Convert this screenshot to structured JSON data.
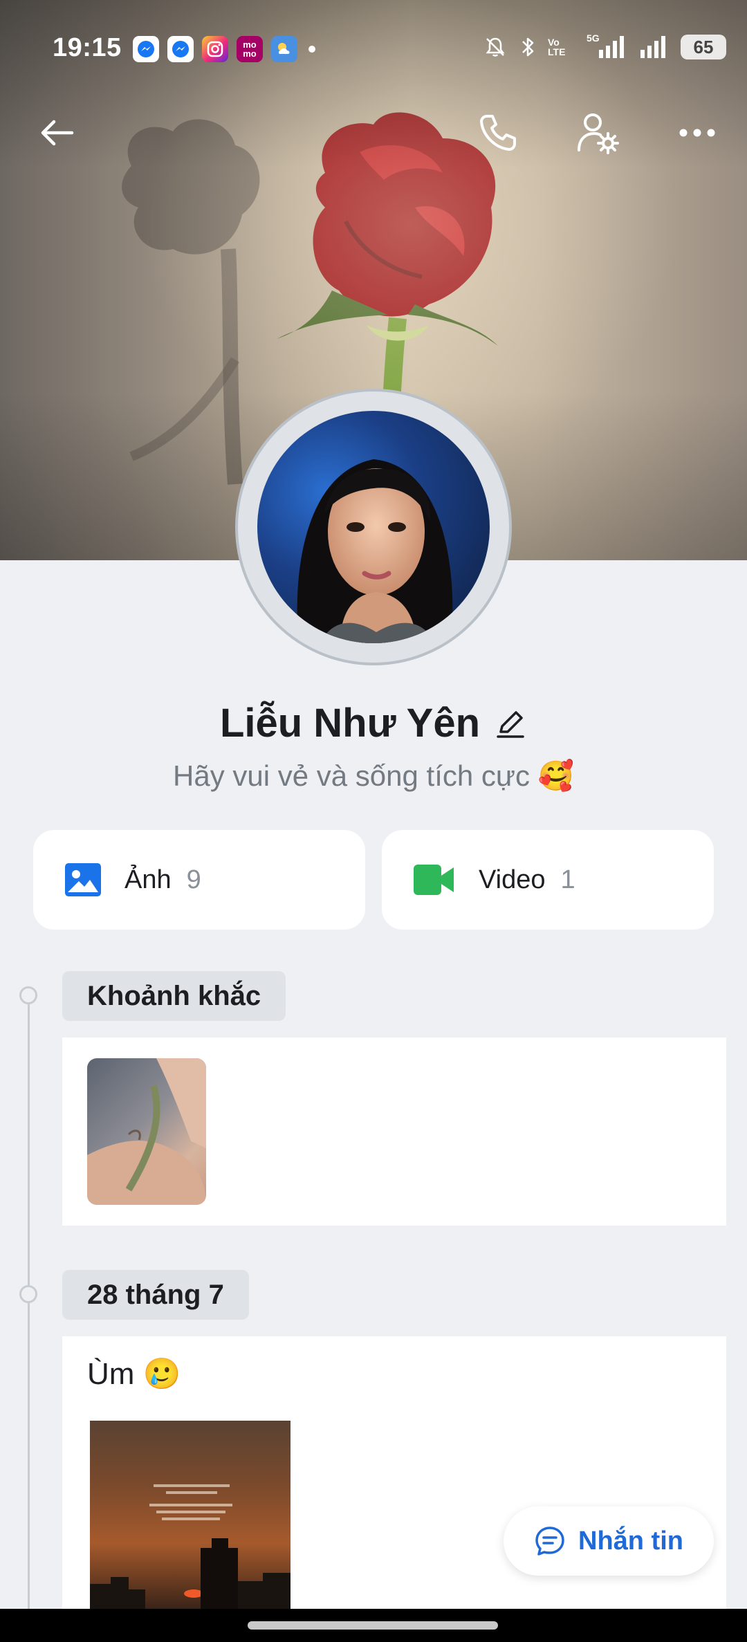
{
  "status_bar": {
    "time": "19:15",
    "battery": "65",
    "network_tag_1": "Vo LTE",
    "network_tag_2": "5G",
    "notification_icons": [
      "messenger-icon",
      "messenger-icon",
      "instagram-icon",
      "momo-icon",
      "weather-icon"
    ],
    "momo_label": "mo mo"
  },
  "profile": {
    "name": "Liễu Như Yên",
    "bio": "Hãy vui vẻ và sống tích cực 🥰"
  },
  "media": {
    "photos": {
      "label": "Ảnh",
      "count": "9"
    },
    "videos": {
      "label": "Video",
      "count": "1"
    }
  },
  "timeline": [
    {
      "tag": "Khoảnh khắc"
    },
    {
      "tag": "28 tháng 7",
      "text": "Ùm 🥲"
    }
  ],
  "fab": {
    "label": "Nhắn tin"
  },
  "colors": {
    "accent": "#1f6ad6",
    "photo_icon": "#1a73e8",
    "video_icon": "#2fb85a",
    "background": "#eef0f4"
  }
}
